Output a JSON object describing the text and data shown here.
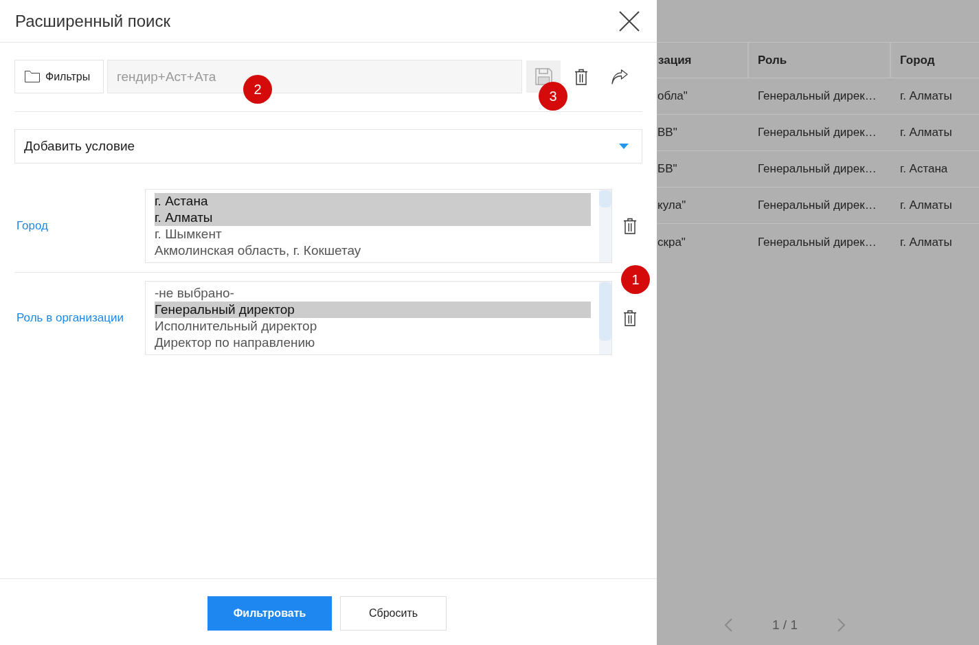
{
  "dialog": {
    "title": "Расширенный поиск"
  },
  "toolbar": {
    "filters_button": "Фильтры",
    "query": {
      "value": "гендир+Аст+Ата",
      "callout": "2"
    },
    "save_button": {
      "callout": "3"
    }
  },
  "add_condition": {
    "label": "Добавить условие"
  },
  "conditions": [
    {
      "label": "Город",
      "options": [
        {
          "text": "г. Астана",
          "selected": true
        },
        {
          "text": "г. Алматы",
          "selected": true
        },
        {
          "text": "г. Шымкент",
          "selected": false
        },
        {
          "text": "Акмолинская область, г. Кокшетау",
          "selected": false
        }
      ]
    },
    {
      "label": "Роль в организации",
      "options": [
        {
          "text": "-не выбрано-",
          "selected": false
        },
        {
          "text": "Генеральный директор",
          "selected": true
        },
        {
          "text": "Исполнительный директор",
          "selected": false
        },
        {
          "text": "Директор по направлению",
          "selected": false
        }
      ]
    }
  ],
  "conditions_callout": "1",
  "footer": {
    "buttons": [
      {
        "label": "Фильтровать",
        "kind": "apply"
      },
      {
        "label": "Сбросить",
        "kind": "reset"
      }
    ]
  },
  "background_table": {
    "columns": [
      "зация",
      "Роль",
      "Город"
    ],
    "rows": [
      [
        "обла\"",
        "Генеральный дирек…",
        "г. Алматы"
      ],
      [
        "ВВ\"",
        "Генеральный дирек…",
        "г. Алматы"
      ],
      [
        "БВ\"",
        "Генеральный дирек…",
        "г. Астана"
      ],
      [
        "кула\"",
        "Генеральный дирек…",
        "г. Алматы"
      ],
      [
        "скра\"",
        "Генеральный дирек…",
        "г. Алматы"
      ]
    ]
  },
  "pagination": {
    "page": "1 / 1"
  }
}
